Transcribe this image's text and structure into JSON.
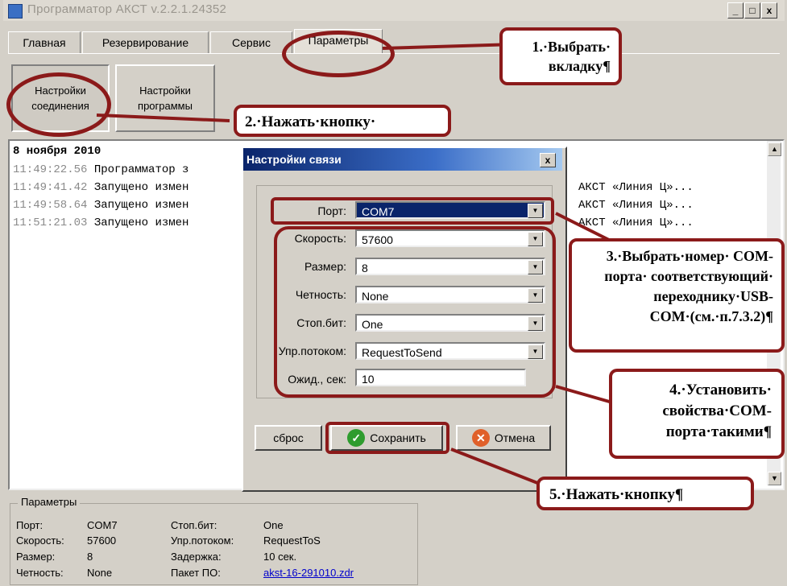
{
  "window": {
    "title": "Программатор АКСТ v.2.2.1.24352",
    "controls": [
      "_",
      "□",
      "x"
    ]
  },
  "tabs": [
    "Главная",
    "Резервирование",
    "Сервис",
    "Параметры"
  ],
  "buttons": {
    "connection_settings": "Настройки соединения",
    "program_settings": "Настройки программы"
  },
  "log": {
    "date": "8 ноября 2010",
    "entries": [
      {
        "time": "11:49:22.56",
        "text": "Программатор з",
        "right": ""
      },
      {
        "time": "11:49:41.42",
        "text": "Запущено измен",
        "right": "АКСТ «Линия Ц»..."
      },
      {
        "time": "11:49:58.64",
        "text": "Запущено измен",
        "right": "АКСТ «Линия Ц»..."
      },
      {
        "time": "11:51:21.03",
        "text": "Запущено измен",
        "right": "АКСТ «Линия Ц»..."
      }
    ]
  },
  "dialog": {
    "title": "Настройки связи",
    "close": "x",
    "fields": [
      {
        "label": "Порт:",
        "value": "COM7"
      },
      {
        "label": "Скорость:",
        "value": "57600"
      },
      {
        "label": "Размер:",
        "value": "8"
      },
      {
        "label": "Четность:",
        "value": "None"
      },
      {
        "label": "Стоп.бит:",
        "value": "One"
      },
      {
        "label": "Упр.потоком:",
        "value": "RequestToSend"
      },
      {
        "label": "Ожид., сек:",
        "value": "10"
      }
    ],
    "reset": "сброс",
    "save": "Сохранить",
    "cancel": "Отмена"
  },
  "params": {
    "legend": "Параметры",
    "port_label": "Порт:",
    "port": "COM7",
    "speed_label": "Скорость:",
    "speed": "57600",
    "size_label": "Размер:",
    "size": "8",
    "parity_label": "Четность:",
    "parity": "None",
    "stop_label": "Стоп.бит:",
    "stop": "One",
    "flow_label": "Упр.потоком:",
    "flow": "RequestToS",
    "delay_label": "Задержка:",
    "delay": "10 сек.",
    "package_label": "Пакет ПО:",
    "package": "akst-16-291010.zdr"
  },
  "callouts": {
    "c1": "1.·Выбрать· вкладку¶",
    "c2": "2.·Нажать·кнопку·",
    "c3": "3.·Выбрать·номер· COM-порта· соответствующий· переходнику·USB-COM·(см.·п.7.3.2)¶",
    "c4": "4.·Установить· свойства·COM-порта·такими¶",
    "c5": "5.·Нажать·кнопку¶"
  },
  "colors": {
    "callout_border": "#8b1a1a",
    "dialog_title": "#0a246a",
    "save_icon": "#2e9c2e",
    "cancel_icon": "#e0602a"
  }
}
